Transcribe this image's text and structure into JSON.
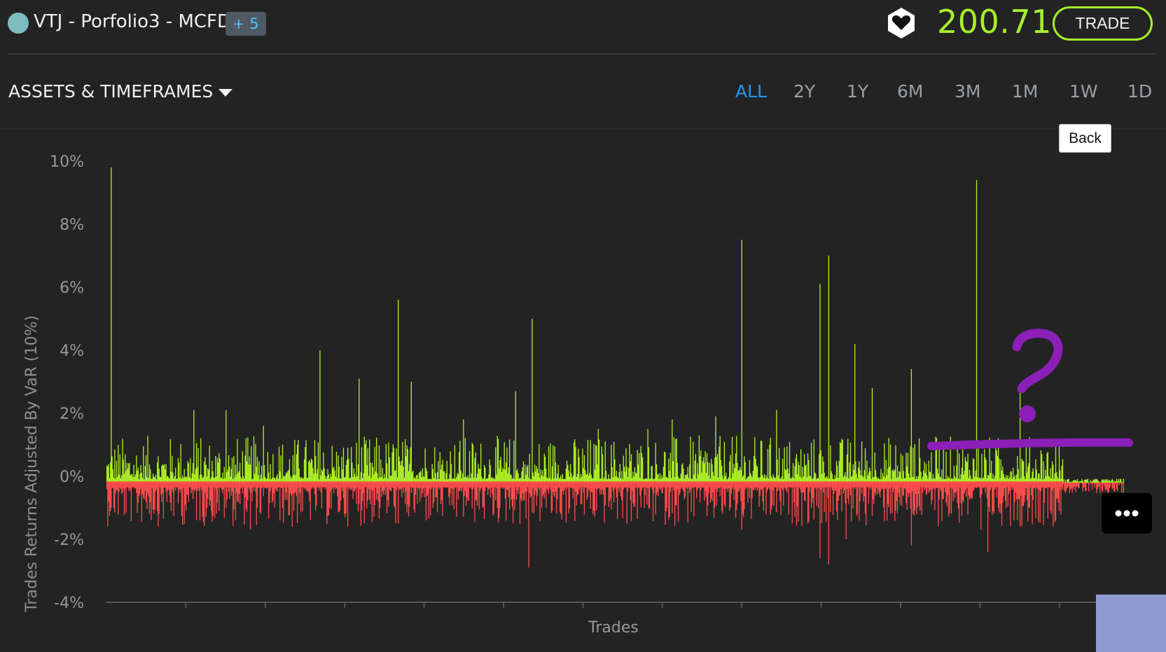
{
  "header": {
    "title": "VTJ - Porfolio3 - MCFD",
    "extra_badge": "+ 5",
    "price": "200.71",
    "trade_label": "TRADE"
  },
  "filters": {
    "assets_label": "ASSETS & TIMEFRAMES",
    "timeframes": [
      "ALL",
      "2Y",
      "1Y",
      "6M",
      "3M",
      "1M",
      "1W",
      "1D"
    ],
    "active": "ALL"
  },
  "controls": {
    "back_label": "Back"
  },
  "icons": {
    "status": "status-dot-icon",
    "favorite": "heart-icon",
    "dropdown": "caret-down-icon",
    "more": "more-dots-icon"
  },
  "colors": {
    "accent_green": "#a6ef2a",
    "positive": "#aef326",
    "negative": "#ff4d4d",
    "active_tab": "#2196f3",
    "annotation": "#8b1fb8",
    "background": "#232323"
  },
  "chart_data": {
    "type": "bar",
    "xlabel": "Trades",
    "ylabel": "Trades Returns Adjusted By VaR (10%)",
    "ylim": [
      -4,
      10
    ],
    "yticks": [
      "10%",
      "8%",
      "6%",
      "4%",
      "2%",
      "0%",
      "-2%",
      "-4%"
    ],
    "ytick_values": [
      10,
      8,
      6,
      4,
      2,
      0,
      -2,
      -4
    ],
    "grid": false,
    "legend": "none",
    "baseline": -0.2,
    "bar_count": 1170,
    "zoom_start_trade": 1100,
    "spikes": [
      {
        "trade": 5,
        "value": 9.8
      },
      {
        "trade": 100,
        "value": 2.1
      },
      {
        "trade": 137,
        "value": 2.1
      },
      {
        "trade": 180,
        "value": 1.6
      },
      {
        "trade": 245,
        "value": 4.0
      },
      {
        "trade": 290,
        "value": 3.1
      },
      {
        "trade": 335,
        "value": 5.6
      },
      {
        "trade": 350,
        "value": 3.0
      },
      {
        "trade": 410,
        "value": 1.8
      },
      {
        "trade": 470,
        "value": 2.7
      },
      {
        "trade": 489,
        "value": 5.0
      },
      {
        "trade": 565,
        "value": 1.5
      },
      {
        "trade": 622,
        "value": 1.5
      },
      {
        "trade": 650,
        "value": 1.8
      },
      {
        "trade": 700,
        "value": 1.9
      },
      {
        "trade": 730,
        "value": 7.5
      },
      {
        "trade": 770,
        "value": 2.1
      },
      {
        "trade": 820,
        "value": 6.1
      },
      {
        "trade": 830,
        "value": 7.0
      },
      {
        "trade": 860,
        "value": 4.2
      },
      {
        "trade": 880,
        "value": 2.8
      },
      {
        "trade": 925,
        "value": 3.4
      },
      {
        "trade": 1000,
        "value": 9.4
      },
      {
        "trade": 1050,
        "value": 2.8
      }
    ],
    "dips": [
      {
        "trade": 5,
        "value": -1.0
      },
      {
        "trade": 165,
        "value": -1.7
      },
      {
        "trade": 213,
        "value": -1.6
      },
      {
        "trade": 335,
        "value": -1.5
      },
      {
        "trade": 485,
        "value": -2.9
      },
      {
        "trade": 560,
        "value": -1.1
      },
      {
        "trade": 730,
        "value": -1.7
      },
      {
        "trade": 820,
        "value": -2.6
      },
      {
        "trade": 830,
        "value": -2.8
      },
      {
        "trade": 850,
        "value": -2.0
      },
      {
        "trade": 925,
        "value": -2.2
      },
      {
        "trade": 1005,
        "value": -1.7
      },
      {
        "trade": 1013,
        "value": -2.4
      },
      {
        "trade": 1050,
        "value": -1.6
      }
    ]
  }
}
